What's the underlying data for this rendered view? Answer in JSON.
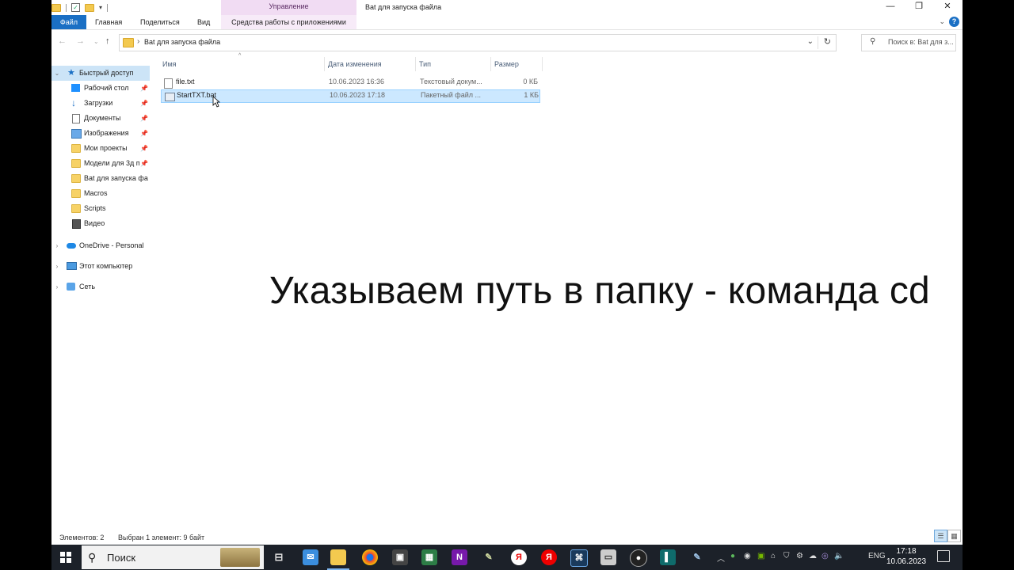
{
  "window": {
    "title": "Bat для запуска файла",
    "context_tab_header": "Управление",
    "controls": {
      "minimize": "—",
      "maximize": "❐",
      "close": "✕"
    }
  },
  "ribbon": {
    "tabs": [
      "Файл",
      "Главная",
      "Поделиться",
      "Вид",
      "Средства работы с приложениями"
    ],
    "help": "?"
  },
  "address": {
    "path": "Bat для запуска файла",
    "search_placeholder": "Поиск в: Bat для з..."
  },
  "navigation": {
    "quick_access": "Быстрый доступ",
    "quick_items": [
      "Рабочий стол",
      "Загрузки",
      "Документы",
      "Изображения",
      "Мои проекты",
      "Модели для 3д п",
      "Bat для запуска фа",
      "Macros",
      "Scripts",
      "Видео"
    ],
    "onedrive": "OneDrive - Personal",
    "this_pc": "Этот компьютер",
    "network": "Сеть"
  },
  "columns": [
    "Имя",
    "Дата изменения",
    "Тип",
    "Размер"
  ],
  "files": [
    {
      "name": "file.txt",
      "date": "10.06.2023 16:36",
      "type": "Текстовый докум...",
      "size": "0 КБ"
    },
    {
      "name": "StartTXT.bat",
      "date": "10.06.2023 17:18",
      "type": "Пакетный файл ...",
      "size": "1 КБ"
    }
  ],
  "caption": "Указываем путь в папку - команда cd",
  "status": {
    "count": "Элементов: 2",
    "selected": "Выбран 1 элемент: 9 байт"
  },
  "taskbar": {
    "search_label": "Поиск",
    "lang": "ENG",
    "time": "17:18",
    "date": "10.06.2023"
  }
}
